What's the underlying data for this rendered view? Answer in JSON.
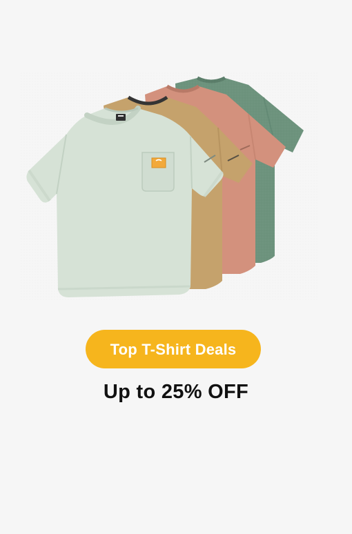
{
  "promo": {
    "button_label": "Top T-Shirt Deals",
    "headline": "Up to 25% OFF"
  },
  "image": {
    "subject": "tshirt-stack",
    "shirts": [
      {
        "color_name": "sage green",
        "color": "#6d937d"
      },
      {
        "color_name": "terracotta",
        "color": "#d3917d"
      },
      {
        "color_name": "tan heather",
        "color": "#c5a26c"
      },
      {
        "color_name": "mint",
        "color": "#d6e2d6"
      }
    ]
  },
  "colors": {
    "background": "#f6f6f6",
    "accent": "#f6b51d",
    "button_text": "#ffffff",
    "headline_text": "#111111"
  }
}
